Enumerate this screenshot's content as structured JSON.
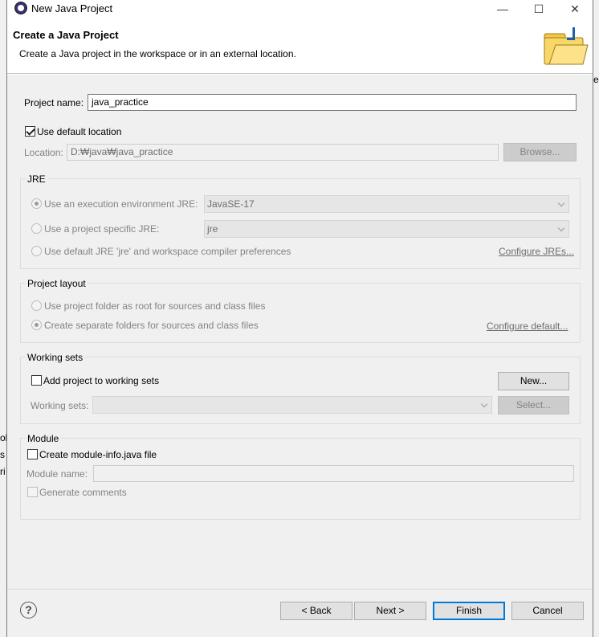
{
  "window": {
    "title": "New Java Project",
    "minimize": "—",
    "maximize": "☐",
    "close": "✕"
  },
  "header": {
    "title": "Create a Java Project",
    "description": "Create a Java project in the workspace or in an external location."
  },
  "project": {
    "name_label": "Project name:",
    "name_value": "java_practice",
    "use_default_location_label": "Use default location",
    "use_default_location_checked": true,
    "location_label": "Location:",
    "location_value": "D:₩java₩java_practice",
    "browse_label": "Browse..."
  },
  "jre": {
    "group_title": "JRE",
    "option_env_label": "Use an execution environment JRE:",
    "option_env_value": "JavaSE-17",
    "option_specific_label": "Use a project specific JRE:",
    "option_specific_value": "jre",
    "option_default_label": "Use default JRE 'jre' and workspace compiler preferences",
    "configure_link": "Configure JREs...",
    "selected": "env"
  },
  "layout": {
    "group_title": "Project layout",
    "option_root_label": "Use project folder as root for sources and class files",
    "option_separate_label": "Create separate folders for sources and class files",
    "configure_link": "Configure default...",
    "selected": "separate"
  },
  "working_sets": {
    "group_title": "Working sets",
    "add_label": "Add project to working sets",
    "new_button": "New...",
    "sets_label": "Working sets:",
    "select_button": "Select..."
  },
  "module": {
    "group_title": "Module",
    "create_label": "Create module-info.java file",
    "name_label": "Module name:",
    "generate_label": "Generate comments"
  },
  "background_fragments": {
    "right_e": "e.",
    "left_o": "ol",
    "left_s": "s",
    "left_r": "ri"
  },
  "footer": {
    "help_symbol": "?",
    "back": "< Back",
    "next": "Next >",
    "finish": "Finish",
    "cancel": "Cancel"
  },
  "colors": {
    "dialog_bg": "#f0f0f0",
    "default_button_border": "#0078d7",
    "folder_icon": "#f5c842"
  }
}
